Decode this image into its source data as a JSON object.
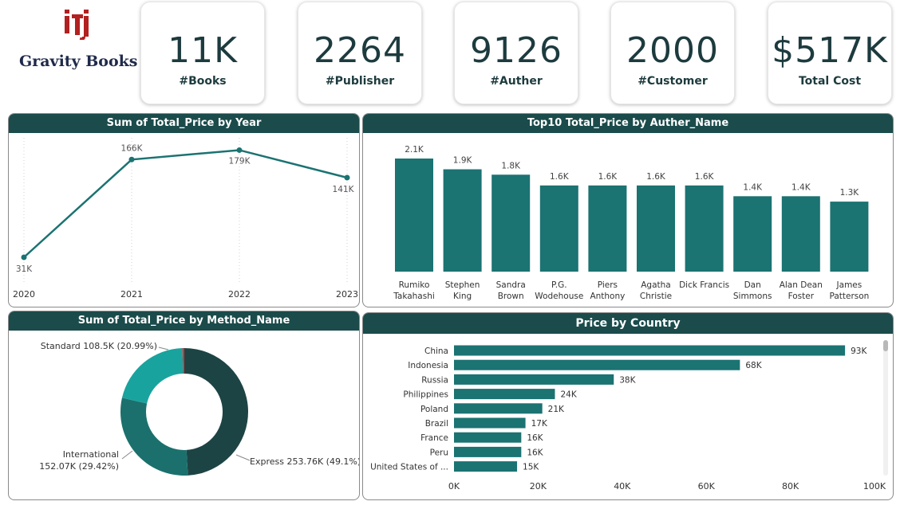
{
  "brand": {
    "name": "Gravity Books"
  },
  "kpis": [
    {
      "value": "11K",
      "label": "#Books"
    },
    {
      "value": "2264",
      "label": "#Publisher"
    },
    {
      "value": "9126",
      "label": "#Auther"
    },
    {
      "value": "2000",
      "label": "#Customer"
    },
    {
      "value": "$517K",
      "label": "Total Cost"
    }
  ],
  "colors": {
    "header": "#1b4b4b",
    "teal": "#1b7372",
    "brand_red": "#b22020",
    "pie_dark": "#1d4444",
    "pie_mid": "#1b706d",
    "pie_light": "#19a39e",
    "pie_sliver": "#d13438"
  },
  "chart_data": [
    {
      "type": "line",
      "title": "Sum of Total_Price by Year",
      "x": [
        "2020",
        "2021",
        "2022",
        "2023"
      ],
      "values": [
        31,
        166,
        179,
        141
      ],
      "labels": [
        "31K",
        "166K",
        "179K",
        "141K"
      ],
      "grid": "vertical dotted"
    },
    {
      "type": "bar",
      "title": "Top10 Total_Price by Auther_Name",
      "categories": [
        [
          "Rumiko",
          "Takahashi"
        ],
        [
          "Stephen",
          "King"
        ],
        [
          "Sandra",
          "Brown"
        ],
        [
          "P.G.",
          "Wodehouse"
        ],
        [
          "Piers",
          "Anthony"
        ],
        [
          "Agatha",
          "Christie"
        ],
        [
          "Dick Francis"
        ],
        [
          "Dan",
          "Simmons"
        ],
        [
          "Alan Dean",
          "Foster"
        ],
        [
          "James",
          "Patterson"
        ]
      ],
      "values": [
        2.1,
        1.9,
        1.8,
        1.6,
        1.6,
        1.6,
        1.6,
        1.4,
        1.4,
        1.3
      ],
      "labels": [
        "2.1K",
        "1.9K",
        "1.8K",
        "1.6K",
        "1.6K",
        "1.6K",
        "1.6K",
        "1.4K",
        "1.4K",
        "1.3K"
      ]
    },
    {
      "type": "pie",
      "title": "Sum of Total_Price by Method_Name",
      "slices": [
        {
          "name": "Express",
          "value": 253.76,
          "pct": 49.1,
          "label": "Express 253.76K (49.1%)"
        },
        {
          "name": "International",
          "value": 152.07,
          "pct": 29.42,
          "label_lines": [
            "International",
            "152.07K (29.42%)"
          ]
        },
        {
          "name": "Standard",
          "value": 108.5,
          "pct": 20.99,
          "label": "Standard 108.5K (20.99%)"
        },
        {
          "name": "",
          "value": 2.5,
          "pct": 0.49
        }
      ]
    },
    {
      "type": "bar",
      "orientation": "horizontal",
      "title": "Price by Country",
      "categories": [
        "China",
        "Indonesia",
        "Russia",
        "Philippines",
        "Poland",
        "Brazil",
        "France",
        "Peru",
        "United States of ..."
      ],
      "values": [
        93,
        68,
        38,
        24,
        21,
        17,
        16,
        16,
        15
      ],
      "labels": [
        "93K",
        "68K",
        "38K",
        "24K",
        "21K",
        "17K",
        "16K",
        "16K",
        "15K"
      ],
      "xlim": [
        0,
        100
      ],
      "xticks": [
        "0K",
        "20K",
        "40K",
        "60K",
        "80K",
        "100K"
      ]
    }
  ]
}
